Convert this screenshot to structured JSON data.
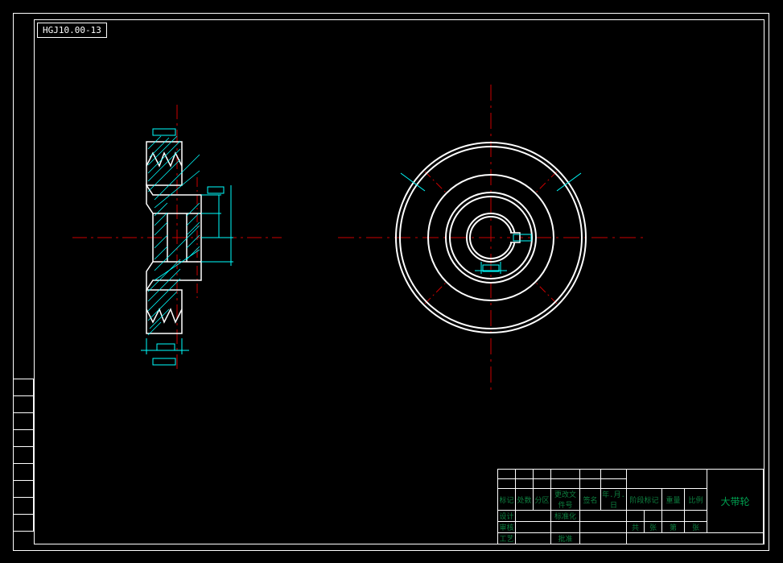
{
  "drawing_id": "HGJ10.00-13",
  "part_name": "大带轮",
  "title_block": {
    "row1": [
      "标记",
      "处数",
      "分区",
      "更改文件号",
      "签名",
      "年.月.日"
    ],
    "row2_left": [
      "设计",
      "",
      "标准化",
      ""
    ],
    "row2_right_headers": [
      "阶段标记",
      "重量",
      "比例"
    ],
    "row3_left": [
      "审核",
      ""
    ],
    "row4_left": [
      "工艺",
      "",
      "批准",
      ""
    ],
    "row4_right": [
      "共",
      "张",
      "第",
      "张"
    ]
  },
  "views": {
    "section": "Section view of double V-groove pulley with hub and keyway",
    "front": "Front view concentric circles with center marks and keyway"
  }
}
